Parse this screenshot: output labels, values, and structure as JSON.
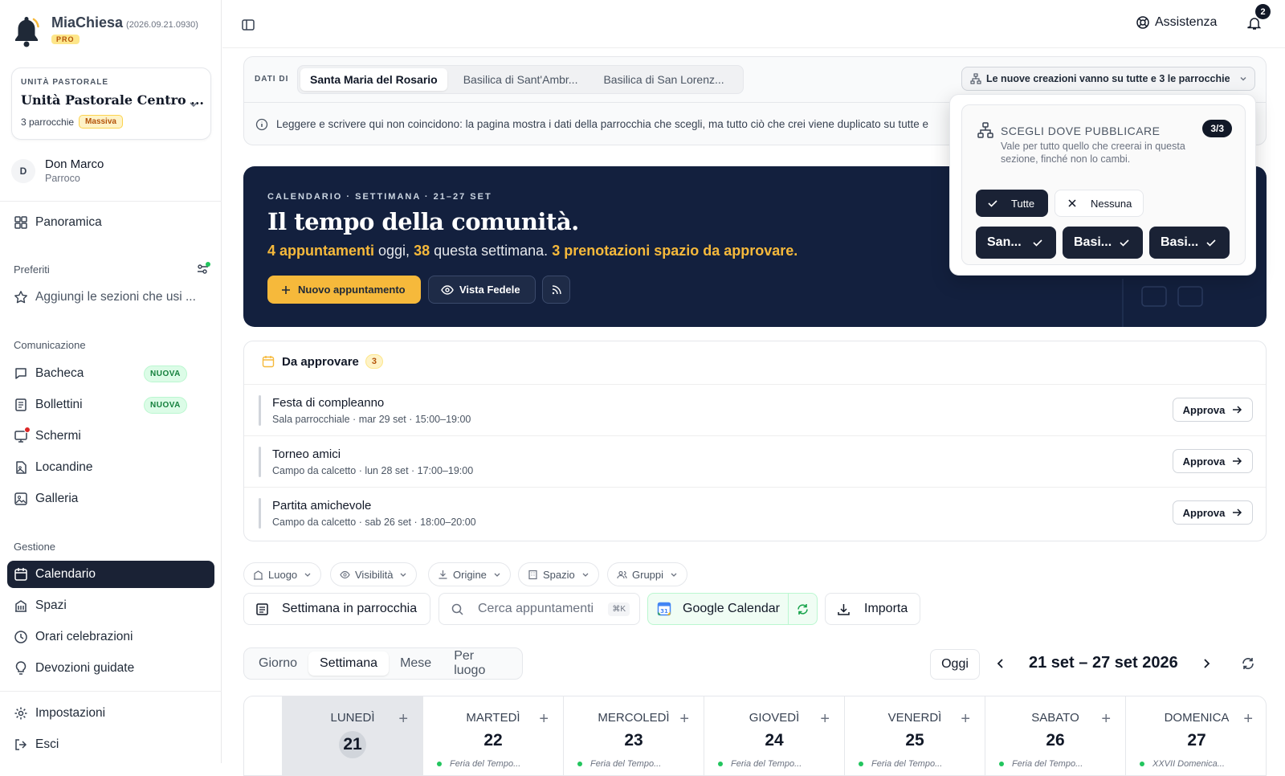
{
  "app": {
    "name": "MiaChiesa",
    "version": "(2026.09.21.0930)",
    "tier": "PRO"
  },
  "unit": {
    "label": "UNITÀ PASTORALE",
    "name": "Unità Pastorale Centro ...",
    "count": "3 parrocchie",
    "mode": "Massiva"
  },
  "user": {
    "initial": "D",
    "name": "Don Marco",
    "role": "Parroco"
  },
  "sidebar": {
    "overview": "Panoramica",
    "favorites_header": "Preferiti",
    "favorites_hint": "Aggiungi le sezioni che usi ...",
    "comm_header": "Comunicazione",
    "comm": [
      {
        "label": "Bacheca",
        "badge": "NUOVA"
      },
      {
        "label": "Bollettini",
        "badge": "NUOVA"
      },
      {
        "label": "Schermi"
      },
      {
        "label": "Locandine"
      },
      {
        "label": "Galleria"
      }
    ],
    "mgmt_header": "Gestione",
    "mgmt": [
      {
        "label": "Calendario"
      },
      {
        "label": "Spazi"
      },
      {
        "label": "Orari celebrazioni"
      },
      {
        "label": "Devozioni guidate"
      }
    ],
    "settings": "Impostazioni",
    "logout": "Esci"
  },
  "header": {
    "help": "Assistenza",
    "notifications": "2"
  },
  "dati": {
    "label": "DATI DI",
    "parishes": [
      "Santa Maria del Rosario",
      "Basilica di Sant'Ambr...",
      "Basilica di San Lorenz..."
    ],
    "info": "Leggere e scrivere qui non coincidono: la pagina mostra i dati della parrocchia che scegli, ma tutto ciò che crei viene duplicato su tutte e",
    "publish_btn": "Le nuove creazioni vanno su tutte e 3 le parrocchie"
  },
  "popover": {
    "title": "SCEGLI DOVE PUBBLICARE",
    "count": "3/3",
    "desc": "Vale per tutto quello che creerai in questa sezione, finché non lo cambi.",
    "all": "Tutte",
    "none": "Nessuna",
    "targets": [
      "San...",
      "Basi...",
      "Basi..."
    ]
  },
  "hero": {
    "kicker": "CALENDARIO · SETTIMANA · 21–27 SET",
    "title": "Il tempo della comunità.",
    "today": "4 appuntamenti",
    "today_suffix": " oggi, ",
    "week": "38",
    "week_suffix": " questa settimana. ",
    "pending": "3 prenotazioni spazio da approvare.",
    "new_btn": "Nuovo appuntamento",
    "view_btn": "Vista Fedele"
  },
  "approvals": {
    "title": "Da approvare",
    "count": "3",
    "action": "Approva",
    "items": [
      {
        "title": "Festa di compleanno",
        "meta": "Sala parrocchiale · mar 29 set · 15:00–19:00"
      },
      {
        "title": "Torneo amici",
        "meta": "Campo da calcetto · lun 28 set · 17:00–19:00"
      },
      {
        "title": "Partita amichevole",
        "meta": "Campo da calcetto · sab 26 set · 18:00–20:00"
      }
    ]
  },
  "filters": [
    "Luogo",
    "Visibilità",
    "Origine",
    "Spazio",
    "Gruppi"
  ],
  "tools": {
    "week": "Settimana in parrocchia",
    "search_placeholder": "Cerca appuntamenti",
    "shortcut": "⌘K",
    "gcal": "Google Calendar",
    "import": "Importa"
  },
  "views": {
    "tabs": [
      "Giorno",
      "Settimana",
      "Mese",
      "Per luogo"
    ],
    "today": "Oggi",
    "range": "21 set – 27 set 2026"
  },
  "week": [
    {
      "d": "LUNEDÌ",
      "n": "21",
      "f": ""
    },
    {
      "d": "MARTEDÌ",
      "n": "22",
      "f": "Feria del Tempo..."
    },
    {
      "d": "MERCOLEDÌ",
      "n": "23",
      "f": "Feria del Tempo..."
    },
    {
      "d": "GIOVEDÌ",
      "n": "24",
      "f": "Feria del Tempo..."
    },
    {
      "d": "VENERDÌ",
      "n": "25",
      "f": "Feria del Tempo..."
    },
    {
      "d": "SABATO",
      "n": "26",
      "f": "Feria del Tempo..."
    },
    {
      "d": "DOMENICA",
      "n": "27",
      "f": "XXVII Domenica..."
    }
  ],
  "colors": {
    "accent": "#f6b93b",
    "navy": "#13203e",
    "dark": "#1a2235"
  }
}
